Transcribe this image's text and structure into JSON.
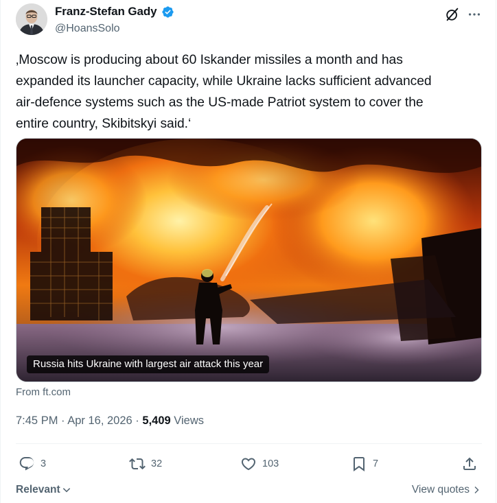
{
  "author": {
    "display_name": "Franz-Stefan Gady",
    "handle": "@HoansSolo",
    "verified": true,
    "verified_color": "#1d9bf0"
  },
  "header_icons": {
    "grok": "grok-icon",
    "more": "more-icon"
  },
  "tweet": {
    "text": "‚Moscow is producing about 60 Iskander missiles a month and has\nexpanded its launcher capacity, while Ukraine lacks sufficient advanced\nair-defence systems such as the US-made Patriot system to cover the\nentire country, Skibitskyi said.‘"
  },
  "card": {
    "caption": "Russia hits Ukraine with largest air attack this year",
    "source": "From ft.com"
  },
  "meta": {
    "time": "7:45 PM",
    "sep1": " · ",
    "date": "Apr 16, 2026",
    "sep2": " · ",
    "views_count": "5,409",
    "views_label": " Views"
  },
  "actions": {
    "replies": "3",
    "reposts": "32",
    "likes": "103",
    "bookmarks": "7"
  },
  "footer": {
    "sort_label": "Relevant",
    "view_quotes": "View quotes"
  },
  "colors": {
    "text_primary": "#0f1419",
    "text_secondary": "#536471",
    "border": "#eff3f4"
  }
}
